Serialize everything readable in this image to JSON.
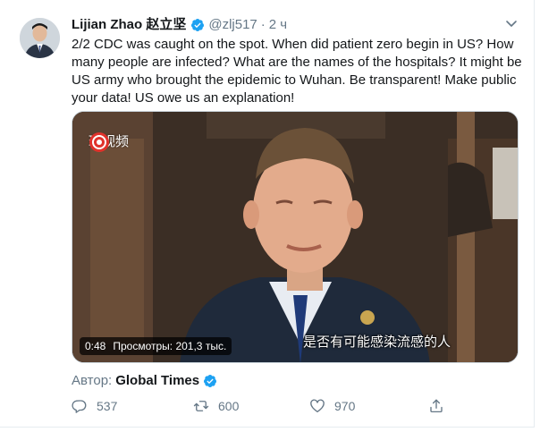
{
  "tweet": {
    "author_name": "Lijian Zhao 赵立坚",
    "handle": "@zlj517",
    "separator": "·",
    "time": "2 ч",
    "text": "2/2 CDC was caught on the spot. When did patient zero begin in US? How many people are infected? What are the names of the hospitals? It might be US army who brought the epidemic to Wuhan. Be transparent! Make public your data! US owe us an explanation!",
    "verified": true
  },
  "media": {
    "watermark_text": "环视频",
    "subtitle": "是否有可能感染流感的人",
    "duration": "0:48",
    "views_label": "Просмотры: 201,3 тыс."
  },
  "attribution": {
    "label": "Автор:",
    "name": "Global Times",
    "verified": true
  },
  "actions": {
    "replies": "537",
    "retweets": "600",
    "likes": "970"
  },
  "icons": {
    "verified": "verified-badge-icon",
    "caret": "chevron-down-icon",
    "reply": "reply-icon",
    "retweet": "retweet-icon",
    "like": "heart-icon",
    "share": "share-icon"
  },
  "colors": {
    "verified_blue": "#1da1f2",
    "secondary_text": "#657786",
    "primary_text": "#14171a"
  }
}
